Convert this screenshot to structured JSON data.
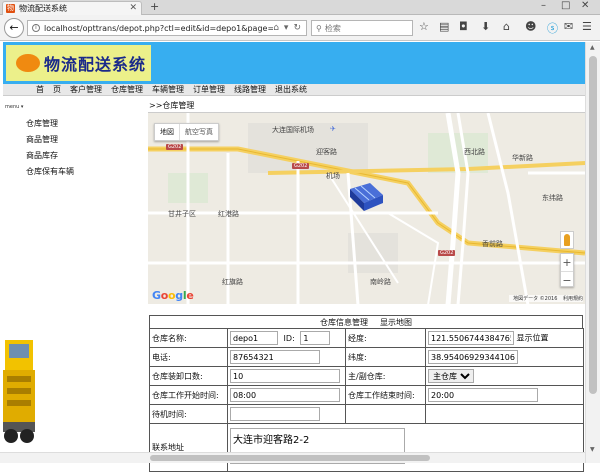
{
  "browser": {
    "tab_title": "物流配送系统",
    "new_tab": "+",
    "url": "localhost/opttrans/depot.php?ctl=edit&id=depo1&page=",
    "search_placeholder": "检索"
  },
  "site": {
    "logo_text": "物流配送系统"
  },
  "nav": {
    "items": [
      "首",
      "页",
      "客户管理",
      "仓库管理",
      "车辆管理",
      "订单管理",
      "线路管理",
      "退出系统"
    ]
  },
  "sidebar": {
    "menu_label": "menu ▾",
    "items": [
      "仓库管理",
      "商品管理",
      "商品库存",
      "仓库保有车辆"
    ]
  },
  "breadcrumb": ">>仓库管理",
  "map": {
    "type_map": "地図",
    "type_satellite": "航空写真",
    "labels": {
      "airport": "大连国际机场",
      "g202a": "G202",
      "g202b": "G202",
      "g202c": "G202",
      "jichang": "机场",
      "yingke": "迎客路",
      "ganjingzi": "甘井子区",
      "honggang": "红港路",
      "honghui": "红旗路",
      "xinqu": "西北路",
      "huaxin": "华新路",
      "dongfeng": "东纬路",
      "nanling": "南岭路",
      "xiangqian": "香前路"
    },
    "footer_data": "地図データ ©2016",
    "footer_terms": "利用規約"
  },
  "form": {
    "caption": "仓库信息管理",
    "show_map": "显示地图",
    "name_label": "仓库名称:",
    "name_value": "depo1",
    "id_label": "ID:",
    "id_value": "1",
    "lng_label": "经度:",
    "lng_value": "121.550674438476562",
    "show_position": "显示位置",
    "phone_label": "电话:",
    "phone_value": "87654321",
    "lat_label": "纬度:",
    "lat_value": "38.95406929344106",
    "dock_label": "仓库装卸口数:",
    "dock_value": "10",
    "type_label": "主/副仓库:",
    "type_value": "主仓库",
    "start_label": "仓库工作开始时间:",
    "start_value": "08:00",
    "end_label": "仓库工作结束时间:",
    "end_value": "20:00",
    "wait_label": "待机时间:",
    "wait_value": "",
    "address_label": "联系地址",
    "address_value": "大连市迎客路2-2"
  },
  "colors": {
    "header_bg": "#37aef0",
    "logo_bg": "#ecf08a",
    "logo_text": "#1a2a8a"
  }
}
